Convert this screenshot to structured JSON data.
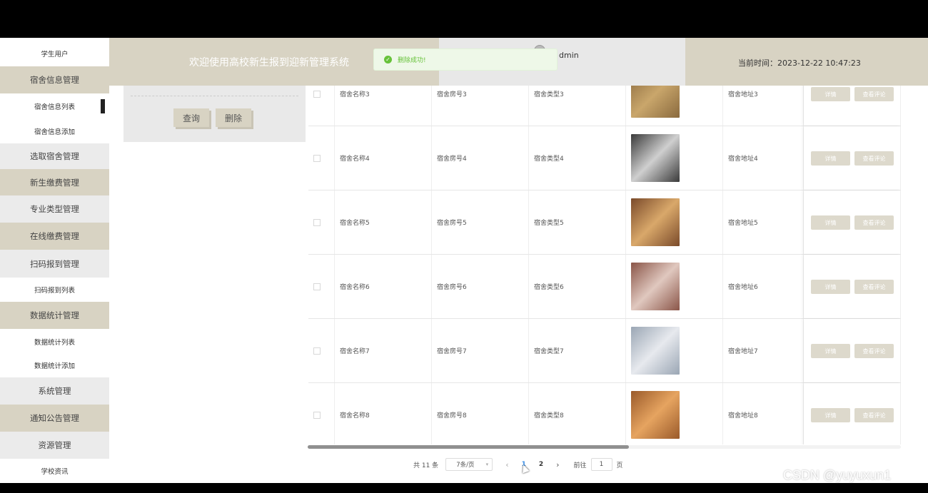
{
  "header": {
    "title": "欢迎使用高校新生报到迎新管理系统",
    "username": "dmin",
    "time": "当前时间：2023-12-22 10:47:23"
  },
  "toast": {
    "text": "删除成功!"
  },
  "sidebar": {
    "items": [
      {
        "label": "学生用户",
        "kind": "sub"
      },
      {
        "label": "宿舍信息管理",
        "kind": "group"
      },
      {
        "label": "宿舍信息列表",
        "kind": "sub",
        "active": true
      },
      {
        "label": "宿舍信息添加",
        "kind": "sub"
      },
      {
        "label": "选取宿舍管理",
        "kind": "light"
      },
      {
        "label": "新生缴费管理",
        "kind": "group"
      },
      {
        "label": "专业类型管理",
        "kind": "light"
      },
      {
        "label": "在线缴费管理",
        "kind": "group"
      },
      {
        "label": "扫码报到管理",
        "kind": "light"
      },
      {
        "label": "扫码报到列表",
        "kind": "sub"
      },
      {
        "label": "数据统计管理",
        "kind": "group"
      },
      {
        "label": "数据统计列表",
        "kind": "sub"
      },
      {
        "label": "数据统计添加",
        "kind": "sub"
      },
      {
        "label": "系统管理",
        "kind": "light"
      },
      {
        "label": "通知公告管理",
        "kind": "group"
      },
      {
        "label": "资源管理",
        "kind": "light"
      },
      {
        "label": "学校资讯",
        "kind": "sub"
      }
    ]
  },
  "search": {
    "query_label": "查询",
    "delete_label": "删除"
  },
  "table": {
    "detail_label": "详情",
    "comment_label": "查看评论",
    "rows": [
      {
        "name": "宿舍名称3",
        "room": "宿舍房号3",
        "type": "宿舍类型3",
        "address": "宿舍地址3"
      },
      {
        "name": "宿舍名称4",
        "room": "宿舍房号4",
        "type": "宿舍类型4",
        "address": "宿舍地址4"
      },
      {
        "name": "宿舍名称5",
        "room": "宿舍房号5",
        "type": "宿舍类型5",
        "address": "宿舍地址5"
      },
      {
        "name": "宿舍名称6",
        "room": "宿舍房号6",
        "type": "宿舍类型6",
        "address": "宿舍地址6"
      },
      {
        "name": "宿舍名称7",
        "room": "宿舍房号7",
        "type": "宿舍类型7",
        "address": "宿舍地址7"
      },
      {
        "name": "宿舍名称8",
        "room": "宿舍房号8",
        "type": "宿舍类型8",
        "address": "宿舍地址8"
      }
    ]
  },
  "pagination": {
    "total": "共 11 条",
    "page_size": "7条/页",
    "pages": [
      "1",
      "2"
    ],
    "current": "1",
    "goto_label": "前往",
    "goto_value": "1",
    "page_suffix": "页"
  },
  "watermark": "CSDN @yuyuxun1",
  "colors": {
    "accent": "#d8d3c3",
    "success": "#67c23a",
    "link": "#3a8ee6"
  }
}
